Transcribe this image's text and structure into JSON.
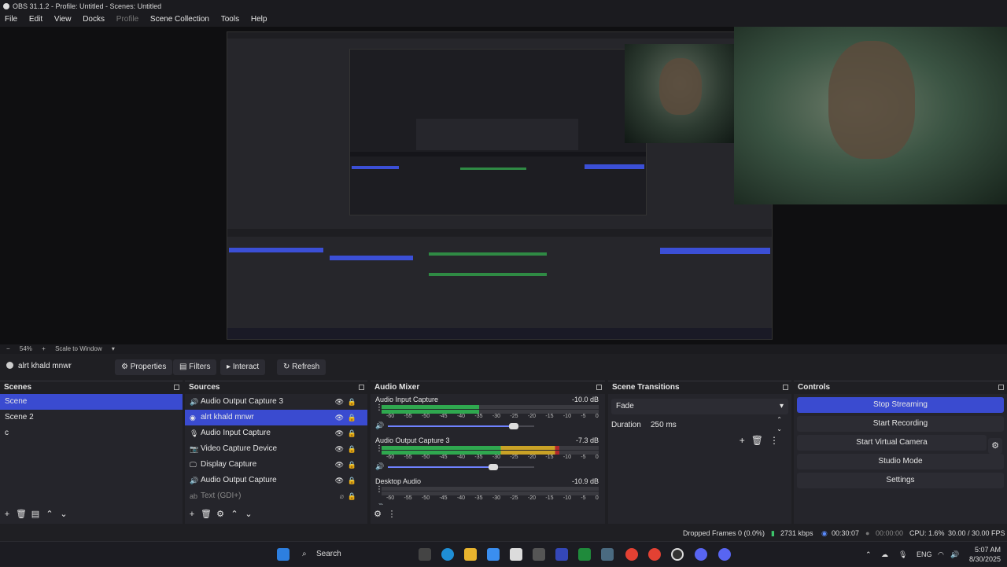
{
  "window": {
    "title": "OBS 31.1.2 - Profile: Untitled - Scenes: Untitled"
  },
  "menu": [
    "File",
    "Edit",
    "View",
    "Docks",
    "Profile",
    "Scene Collection",
    "Tools",
    "Help"
  ],
  "preview_status": {
    "zoom": "54%",
    "scale_mode": "Scale to Window"
  },
  "source_toolbar": {
    "source_name": "alrt khald mnwr",
    "properties": "Properties",
    "filters": "Filters",
    "interact": "Interact",
    "refresh": "Refresh"
  },
  "scenes": {
    "title": "Scenes",
    "items": [
      "Scene",
      "Scene 2",
      "c"
    ],
    "selected": 0
  },
  "sources": {
    "title": "Sources",
    "items": [
      {
        "name": "Audio Output Capture 3",
        "icon": "speaker-icon"
      },
      {
        "name": "alrt khald mnwr",
        "icon": "globe-icon"
      },
      {
        "name": "Audio Input Capture",
        "icon": "microphone-icon"
      },
      {
        "name": "Video Capture Device",
        "icon": "camera-icon"
      },
      {
        "name": "Display Capture",
        "icon": "monitor-icon"
      },
      {
        "name": "Audio Output Capture",
        "icon": "speaker-icon"
      },
      {
        "name": "Text (GDI+)",
        "icon": "text-icon"
      }
    ],
    "selected": 1
  },
  "audio_mixer": {
    "title": "Audio Mixer",
    "scale": [
      "-60",
      "-55",
      "-50",
      "-45",
      "-40",
      "-35",
      "-30",
      "-25",
      "-20",
      "-15",
      "-10",
      "-5",
      "0"
    ],
    "channels": [
      {
        "name": "Audio Input Capture",
        "db": "-10.0 dB",
        "level": 0.45,
        "volume": 0.86
      },
      {
        "name": "Audio Output Capture 3",
        "db": "-7.3 dB",
        "level": 0.82,
        "volume": 0.72
      },
      {
        "name": "Desktop Audio",
        "db": "-10.9 dB",
        "level": 0.0,
        "volume": 0.0
      }
    ]
  },
  "scene_transitions": {
    "title": "Scene Transitions",
    "transition": "Fade",
    "duration_label": "Duration",
    "duration_value": "250 ms"
  },
  "controls": {
    "title": "Controls",
    "buttons": [
      "Stop Streaming",
      "Start Recording",
      "Start Virtual Camera",
      "Studio Mode",
      "Settings"
    ]
  },
  "status": {
    "dropped_frames": "Dropped Frames 0 (0.0%)",
    "bitrate": "2731 kbps",
    "stream_time": "00:30:07",
    "record_time": "00:00:00",
    "cpu": "CPU: 1.6%",
    "fps": "30.00 / 30.00 FPS"
  },
  "taskbar": {
    "search": "Search",
    "lang": "ENG",
    "time": "5:07 AM",
    "date": "8/30/2025"
  },
  "colors": {
    "accent": "#3a4bd0",
    "meter_green": "#2fa84f",
    "meter_yellow": "#c9a226",
    "meter_red": "#b2282c"
  }
}
